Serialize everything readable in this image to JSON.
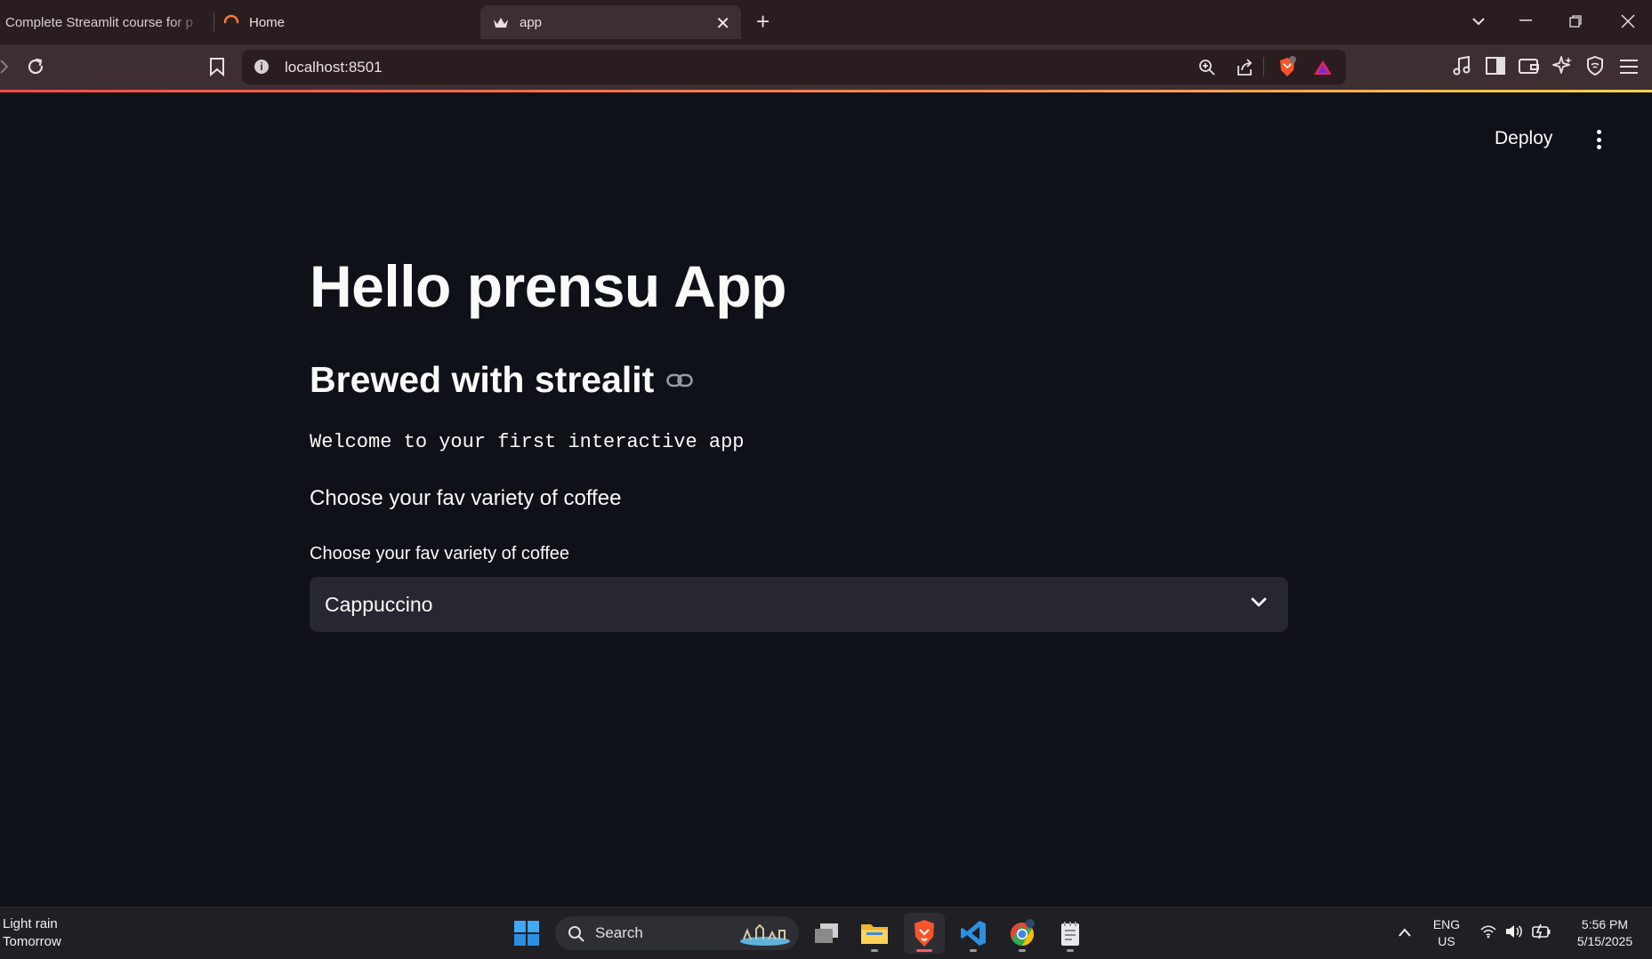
{
  "browser": {
    "tabs": [
      {
        "label": "Complete Streamlit course for p"
      },
      {
        "label": "Home"
      },
      {
        "label": "app"
      }
    ],
    "url": "localhost:8501"
  },
  "app": {
    "deploy_label": "Deploy",
    "title": "Hello prensu App",
    "subheader": "Brewed with strealit",
    "code_text": "Welcome to your first interactive app",
    "text": "Choose your fav variety of coffee",
    "select": {
      "label": "Choose your fav variety of coffee",
      "value": "Cappuccino"
    }
  },
  "taskbar": {
    "weather_line1": "Light rain",
    "weather_line2": "Tomorrow",
    "search_label": "Search",
    "lang_line1": "ENG",
    "lang_line2": "US",
    "time": "5:56 PM",
    "date": "5/15/2025"
  },
  "colors": {
    "app_background": "#0e1117",
    "select_background": "#262730",
    "browser_frame": "#2a1d1f",
    "accent": "#ff4b4b"
  }
}
